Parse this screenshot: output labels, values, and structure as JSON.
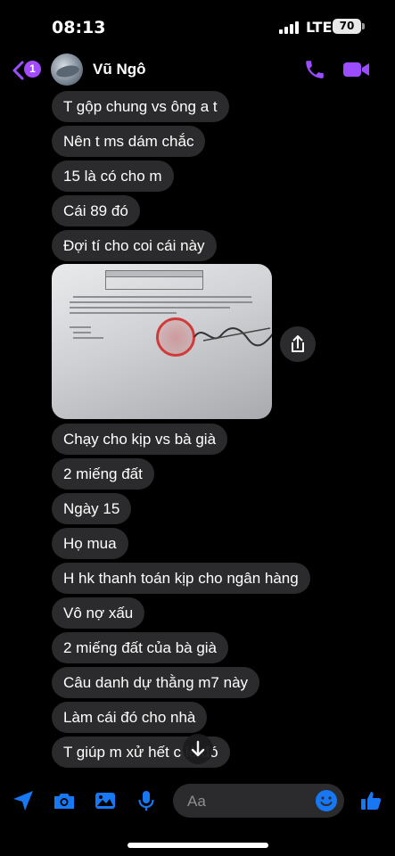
{
  "status_bar": {
    "time": "08:13",
    "network": "LTE",
    "battery": "70"
  },
  "header": {
    "unread_count": "1",
    "contact_name": "Vũ Ngô"
  },
  "messages": [
    {
      "text": "T gộp chung vs ông a t"
    },
    {
      "text": "Nên t ms dám chắc"
    },
    {
      "text": "15 là có cho m"
    },
    {
      "text": "Cái 89 đó"
    },
    {
      "text": "Đợi tí cho coi cái này"
    },
    {
      "text": "Chạy cho kịp vs bà già"
    },
    {
      "text": "2 miếng đất"
    },
    {
      "text": "Ngày 15"
    },
    {
      "text": "Họ mua"
    },
    {
      "text": "H hk thanh toán kịp cho ngân hàng"
    },
    {
      "text": "Vô nợ xấu"
    },
    {
      "text": "2 miếng đất của bà già"
    },
    {
      "text": "Câu danh dự thằng m7 này"
    },
    {
      "text": "Làm cái đó cho nhà"
    },
    {
      "text": "T giúp m xử hết c   lẻ đó"
    }
  ],
  "photo": {
    "stamp_label": "GIÁM ĐỐC",
    "signer_label": "PHÓ GIÁM ĐỐC"
  },
  "composer": {
    "placeholder": "Aa"
  },
  "colors": {
    "accent": "#9b4dff",
    "input_icons": "#1877f2",
    "bubble": "#2b2b2d"
  },
  "icons": {
    "back": "chevron-left-icon",
    "call": "phone-icon",
    "video": "video-camera-icon",
    "share": "share-icon",
    "scroll": "arrow-down-icon",
    "location": "location-arrow-icon",
    "camera": "camera-icon",
    "gallery": "image-icon",
    "mic": "microphone-icon",
    "emoji": "emoji-icon",
    "like": "thumbs-up-icon"
  }
}
